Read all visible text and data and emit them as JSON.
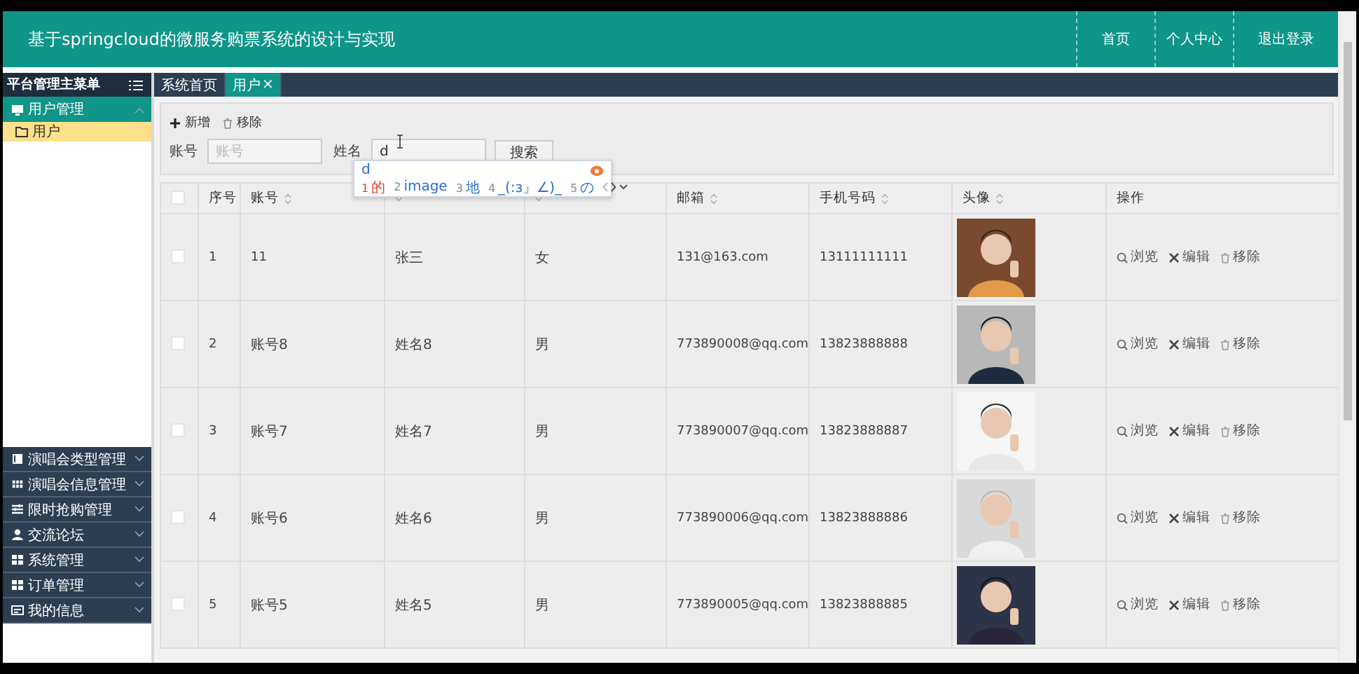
{
  "header": {
    "title": "基于springcloud的微服务购票系统的设计与实现",
    "nav": [
      "首页",
      "个人中心",
      "退出登录"
    ]
  },
  "sidebar": {
    "title": "平台管理主菜单",
    "menus": [
      {
        "label": "用户管理",
        "expanded": true,
        "children": [
          {
            "label": "用户",
            "selected": true
          }
        ]
      },
      {
        "label": "演唱会类型管理",
        "expanded": false
      },
      {
        "label": "演唱会信息管理",
        "expanded": false
      },
      {
        "label": "限时抢购管理",
        "expanded": false
      },
      {
        "label": "交流论坛",
        "expanded": false
      },
      {
        "label": "系统管理",
        "expanded": false
      },
      {
        "label": "订单管理",
        "expanded": false
      },
      {
        "label": "我的信息",
        "expanded": false
      }
    ]
  },
  "tabs": [
    {
      "label": "系统首页",
      "selected": false
    },
    {
      "label": "用户",
      "selected": true,
      "close": "×"
    }
  ],
  "toolbar": {
    "add": "新增",
    "remove": "移除"
  },
  "search": {
    "fields": [
      {
        "label": "账号",
        "placeholder": "账号"
      },
      {
        "label": "姓名",
        "value": "d"
      }
    ],
    "button": "搜索"
  },
  "ime": {
    "input": "d",
    "candidates": [
      {
        "index": "1",
        "text": "的",
        "selected": true
      },
      {
        "index": "2",
        "text": "image",
        "selected": false
      },
      {
        "index": "3",
        "text": "地",
        "selected": false
      },
      {
        "index": "4",
        "text": "_(:з」∠)_",
        "selected": false
      },
      {
        "index": "5",
        "text": "の",
        "selected": false
      }
    ]
  },
  "table": {
    "select_all": {
      "checked": false
    },
    "columns": [
      {
        "kind": "check"
      },
      {
        "label": "序号",
        "sortable": false
      },
      {
        "label": "账号",
        "sortable": true
      },
      {
        "sortable": true
      },
      {
        "sortable": true
      },
      {
        "label": "邮箱",
        "sortable": true
      },
      {
        "label": "手机号码",
        "sortable": true
      },
      {
        "label": "头像",
        "sortable": true
      },
      {
        "label": "操作",
        "sortable": false
      }
    ],
    "rows": [
      {
        "checked": false,
        "no": "1",
        "account": "11",
        "name": "张三",
        "gender": "女",
        "email": "131@163.com",
        "phone": "13111111111",
        "actions": [
          {
            "kind": "view",
            "label": "浏览"
          },
          {
            "kind": "edit",
            "label": "编辑"
          },
          {
            "kind": "delete",
            "label": "移除"
          }
        ]
      },
      {
        "checked": false,
        "no": "2",
        "account": "账号8",
        "name": "姓名8",
        "gender": "男",
        "email": "773890008@qq.com",
        "phone": "13823888888",
        "actions": [
          {
            "kind": "view",
            "label": "浏览"
          },
          {
            "kind": "edit",
            "label": "编辑"
          },
          {
            "kind": "delete",
            "label": "移除"
          }
        ]
      },
      {
        "checked": false,
        "no": "3",
        "account": "账号7",
        "name": "姓名7",
        "gender": "男",
        "email": "773890007@qq.com",
        "phone": "13823888887",
        "actions": [
          {
            "kind": "view",
            "label": "浏览"
          },
          {
            "kind": "edit",
            "label": "编辑"
          },
          {
            "kind": "delete",
            "label": "移除"
          }
        ]
      },
      {
        "checked": false,
        "no": "4",
        "account": "账号6",
        "name": "姓名6",
        "gender": "男",
        "email": "773890006@qq.com",
        "phone": "13823888886",
        "actions": [
          {
            "kind": "view",
            "label": "浏览"
          },
          {
            "kind": "edit",
            "label": "编辑"
          },
          {
            "kind": "delete",
            "label": "移除"
          }
        ]
      },
      {
        "checked": false,
        "no": "5",
        "account": "账号5",
        "name": "姓名5",
        "gender": "男",
        "email": "773890005@qq.com",
        "phone": "13823888885",
        "actions": [
          {
            "kind": "view",
            "label": "浏览"
          },
          {
            "kind": "edit",
            "label": "编辑"
          },
          {
            "kind": "delete",
            "label": "移除"
          }
        ]
      }
    ]
  }
}
